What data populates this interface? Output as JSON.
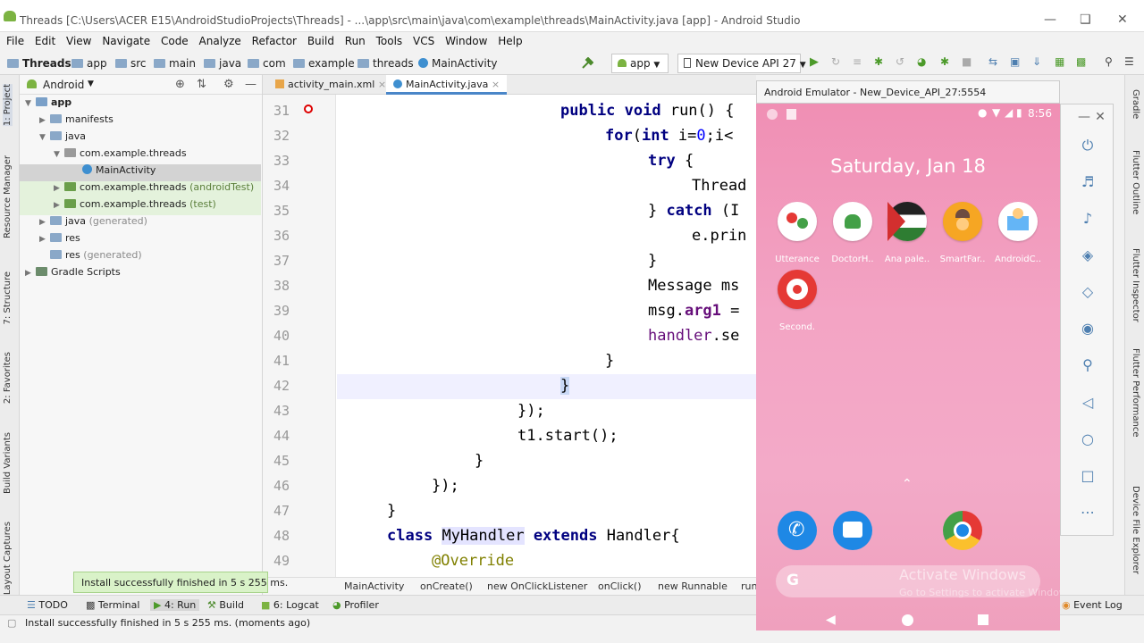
{
  "window": {
    "title": "Threads [C:\\Users\\ACER E15\\AndroidStudioProjects\\Threads] - ...\\app\\src\\main\\java\\com\\example\\threads\\MainActivity.java [app] - Android Studio"
  },
  "menu": [
    "File",
    "Edit",
    "View",
    "Navigate",
    "Code",
    "Analyze",
    "Refactor",
    "Build",
    "Run",
    "Tools",
    "VCS",
    "Window",
    "Help"
  ],
  "breadcrumb": [
    "Threads",
    "app",
    "src",
    "main",
    "java",
    "com",
    "example",
    "threads",
    "MainActivity"
  ],
  "toolbar": {
    "config": "app",
    "device": "New Device API 27"
  },
  "project": {
    "view": "Android",
    "tree": [
      {
        "label": "app",
        "extra": ""
      },
      {
        "label": "manifests",
        "extra": ""
      },
      {
        "label": "java",
        "extra": ""
      },
      {
        "label": "com.example.threads",
        "extra": ""
      },
      {
        "label": "MainActivity",
        "extra": ""
      },
      {
        "label": "com.example.threads",
        "extra": "(androidTest)"
      },
      {
        "label": "com.example.threads",
        "extra": "(test)"
      },
      {
        "label": "java",
        "extra": "(generated)"
      },
      {
        "label": "res",
        "extra": ""
      },
      {
        "label": "res",
        "extra": "(generated)"
      },
      {
        "label": "Gradle Scripts",
        "extra": ""
      }
    ]
  },
  "tabs": [
    "activity_main.xml",
    "MainActivity.java"
  ],
  "left_strip": [
    "1: Project",
    "Resource Manager",
    "7: Structure",
    "2: Favorites",
    "Build Variants",
    "Layout Captures"
  ],
  "right_strip": [
    "Gradle",
    "Flutter Outline",
    "Flutter Inspector",
    "Flutter Performance",
    "Device File Explorer"
  ],
  "editor": {
    "line_numbers": [
      "31",
      "32",
      "33",
      "34",
      "35",
      "36",
      "37",
      "38",
      "39",
      "40",
      "41",
      "42",
      "43",
      "44",
      "45",
      "46",
      "47",
      "48",
      "49"
    ]
  },
  "code_breadcrumbs": [
    "MainActivity",
    "onCreate()",
    "new OnClickListener",
    "onClick()",
    "new Runnable",
    "run"
  ],
  "bottom_tools": [
    "TODO",
    "Terminal",
    "4: Run",
    "Build",
    "6: Logcat",
    "Profiler",
    "Event Log"
  ],
  "toast": "Install successfully finished in 5 s 255 ms.",
  "status": "Install successfully finished in 5 s 255 ms. (moments ago)",
  "emulator": {
    "title": "Android Emulator - New_Device_API_27:5554",
    "time": "8:56",
    "date": "Saturday, Jan 18",
    "apps": [
      "Utterance",
      "DoctorH..",
      "Ana pale..",
      "SmartFar..",
      "AndroidC..",
      "Second."
    ],
    "watermark_title": "Activate Windows",
    "watermark_sub": "Go to Settings to activate Windows."
  }
}
